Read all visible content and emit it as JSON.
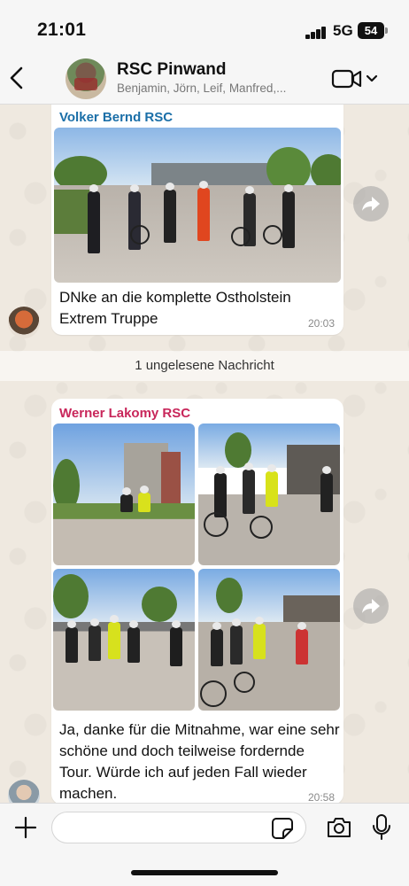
{
  "status_bar": {
    "time": "21:01",
    "network": "5G",
    "battery": "54"
  },
  "header": {
    "title": "RSC Pinwand",
    "members": "Benjamin, Jörn, Leif, Manfred,..."
  },
  "messages": [
    {
      "sender": "Volker Bernd RSC",
      "text": "DNke an die komplette Ostholstein Extrem Truppe",
      "time": "20:03"
    },
    {
      "sender": "Werner Lakomy RSC",
      "text": "Ja, danke für die Mitnahme, war eine sehr schöne und doch teilweise fordernde Tour. Würde ich auf jeden Fall wieder machen.",
      "time": "20:58"
    }
  ],
  "unread_banner": "1 ungelesene Nachricht",
  "input": {
    "placeholder": ""
  },
  "colors": {
    "sender_1": "#1b6fa8",
    "sender_2": "#c8265a",
    "chat_background": "#efe9e0"
  },
  "icons": [
    "back-chevron-icon",
    "video-camera-icon",
    "chevron-down-icon",
    "forward-icon",
    "plus-icon",
    "sticker-icon",
    "camera-icon",
    "microphone-icon"
  ]
}
